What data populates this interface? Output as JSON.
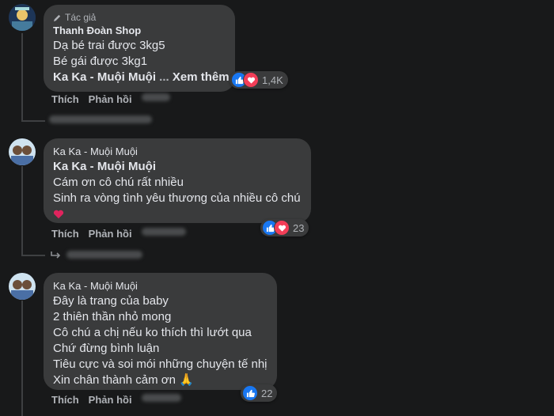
{
  "comments": [
    {
      "badge": "Tác giả",
      "author": "Thanh Đoàn Shop",
      "lines": [
        "Dạ bé trai được 3kg5",
        "Bé gái được 3kg1"
      ],
      "bold_line": "Ka Ka - Muội Muội",
      "see_more": "Xem thêm",
      "reaction_count": "1,4K",
      "actions": {
        "like": "Thích",
        "reply": "Phản hồi"
      }
    },
    {
      "author": "Ka Ka - Muội Muội",
      "bold_line": "Ka Ka - Muội Muội",
      "lines": [
        "Cám ơn cô chú rất nhiều",
        "Sinh ra vòng tình yêu thương của nhiều cô chú"
      ],
      "emoji": "heart",
      "reaction_count": "23",
      "actions": {
        "like": "Thích",
        "reply": "Phản hồi"
      }
    },
    {
      "author": "Ka Ka - Muội Muội",
      "lines": [
        "Đây là trang của baby",
        "2 thiên thần nhỏ mong",
        "Cô chú a chị nếu ko thích thì lướt qua",
        "Chứ đừng bình luận",
        "Tiêu cực và soi mói những chuyện tế nhị",
        "Xin chân thành cảm ơn 🙏"
      ],
      "reaction_count": "22",
      "actions": {
        "like": "Thích",
        "reply": "Phản hồi"
      }
    }
  ],
  "colors": {
    "background": "#18191a",
    "bubble": "#3a3b3c",
    "text": "#e4e6eb",
    "muted": "#b0b3b8",
    "like": "#1877f2",
    "love": "#f33e58"
  }
}
